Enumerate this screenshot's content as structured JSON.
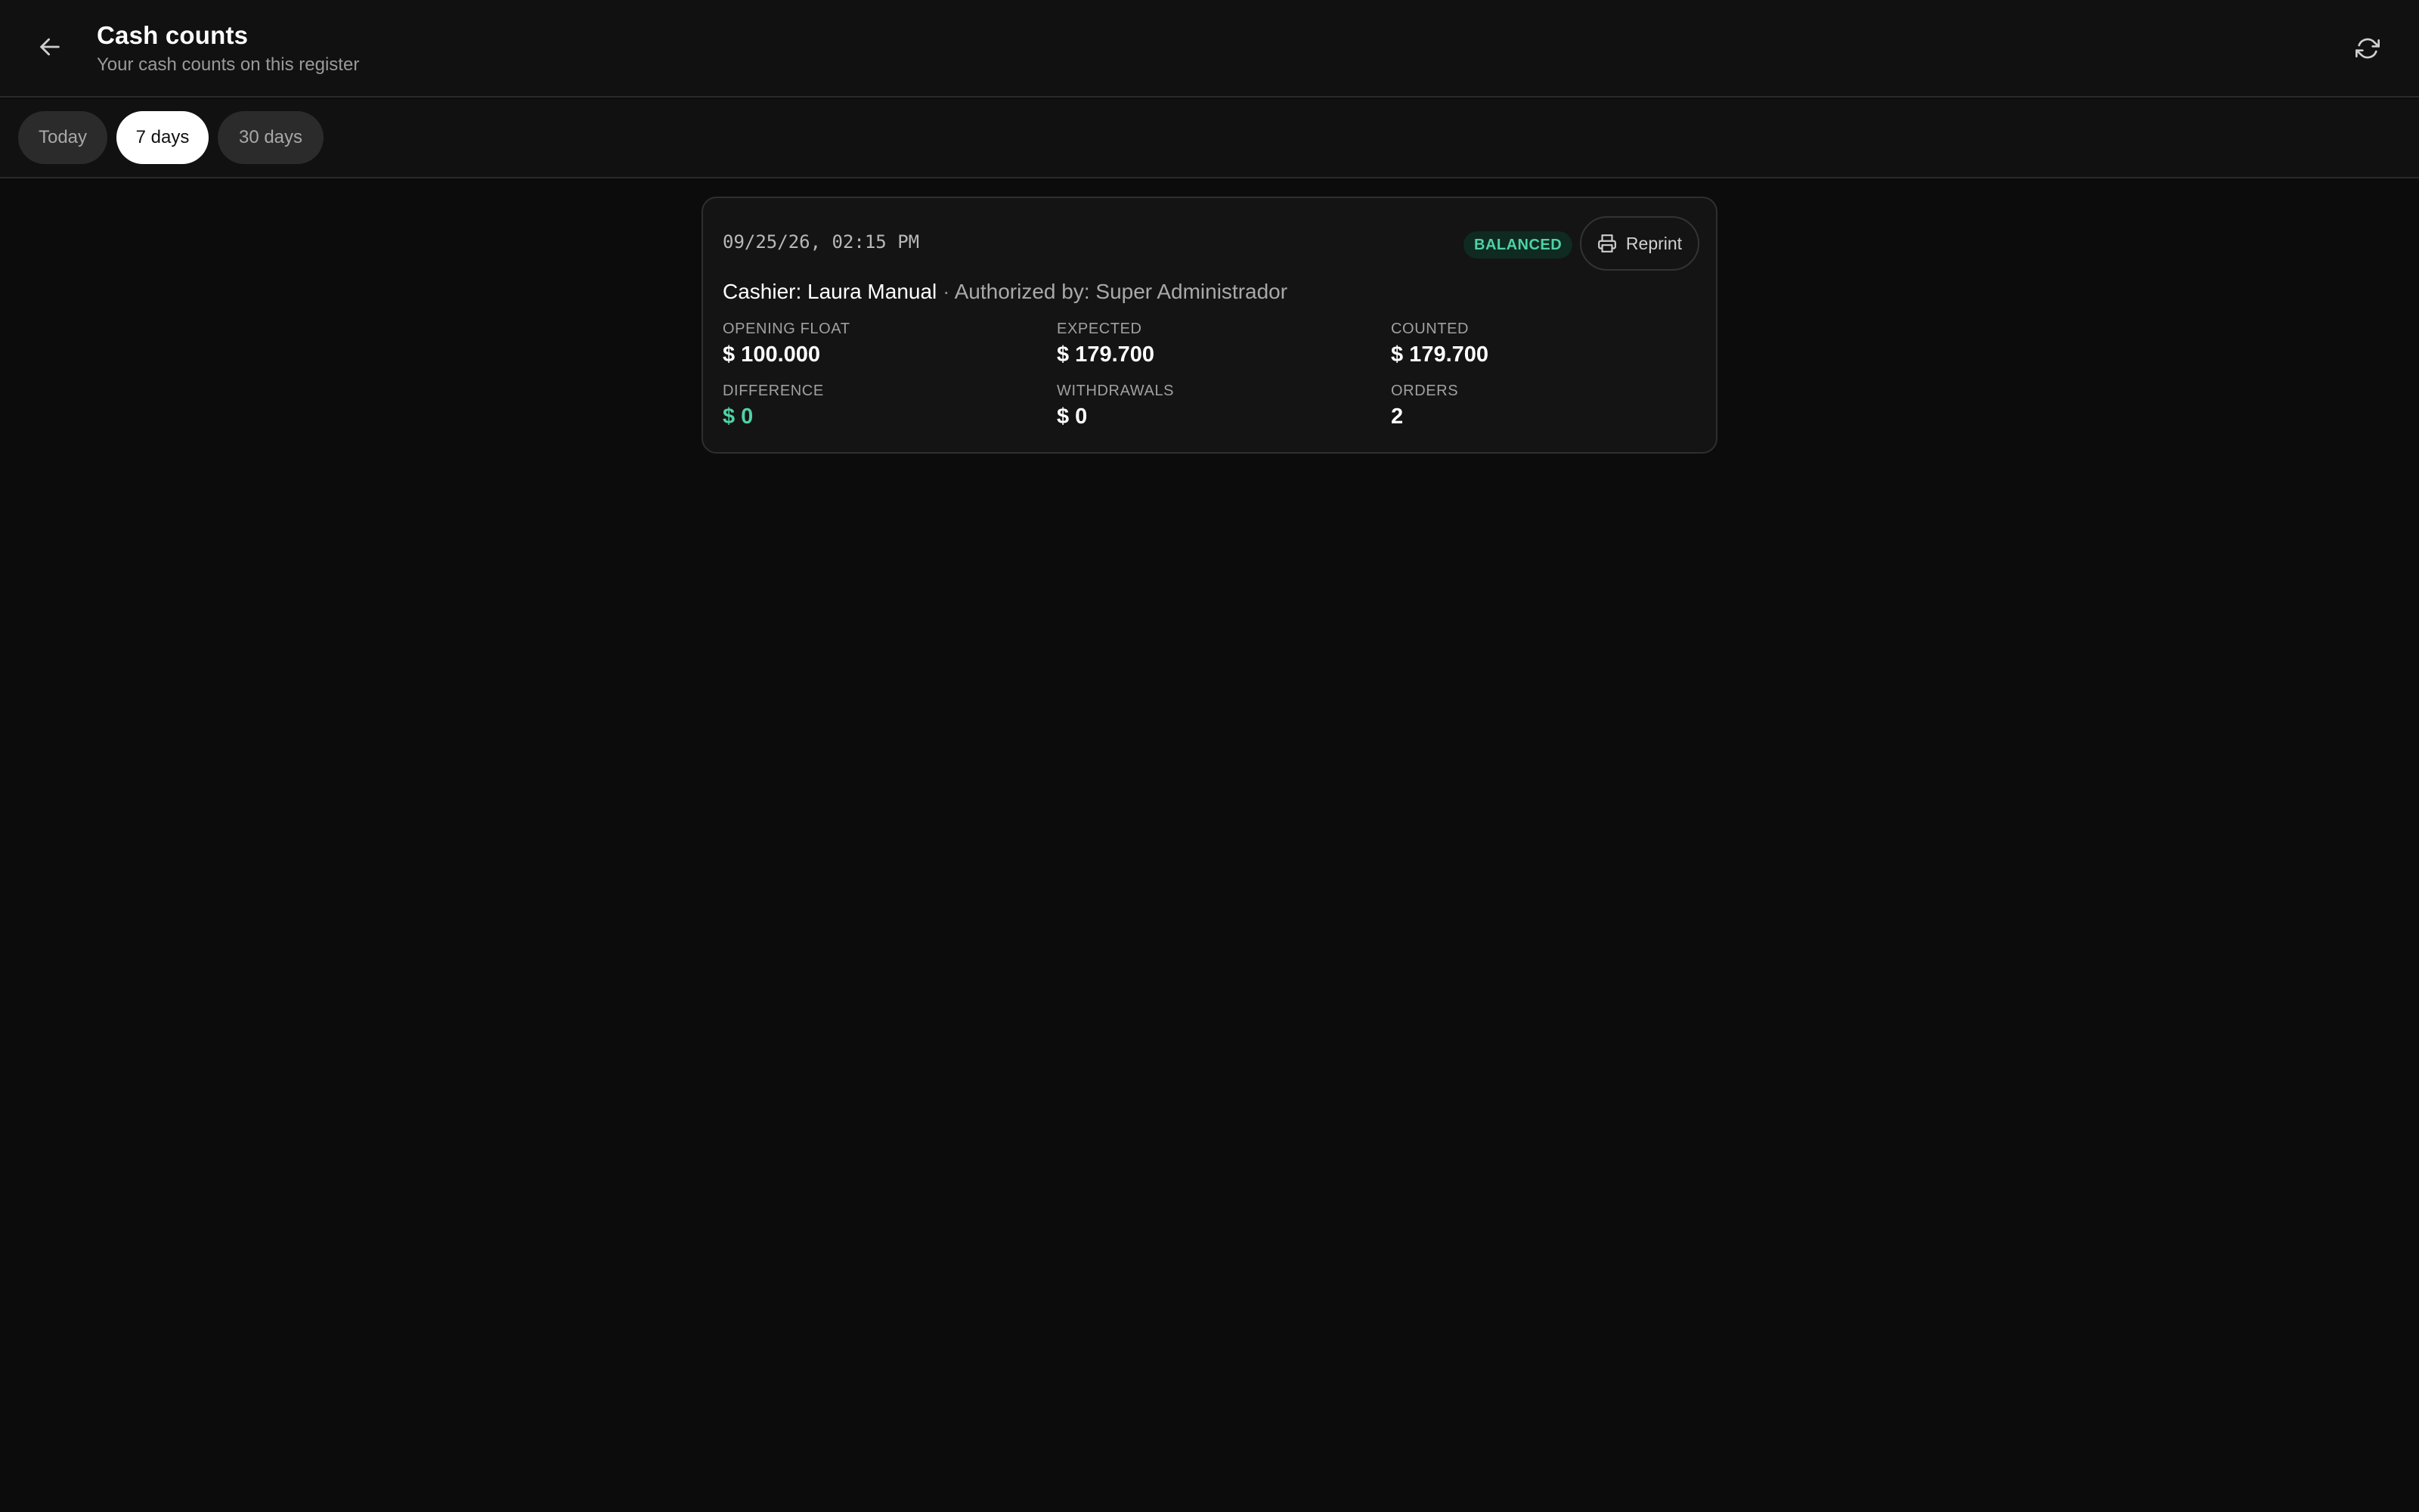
{
  "header": {
    "title": "Cash counts",
    "subtitle": "Your cash counts on this register",
    "back_icon": "arrow-left-icon",
    "refresh_icon": "refresh-icon"
  },
  "filters": {
    "options": [
      {
        "label": "Today",
        "selected": false
      },
      {
        "label": "7 days",
        "selected": true
      },
      {
        "label": "30 days",
        "selected": false
      }
    ]
  },
  "counts": [
    {
      "datetime": "09/25/26, 02:15 PM",
      "status": "BALANCED",
      "status_color": "#4fd1a5",
      "reprint_label": "Reprint",
      "reprint_icon": "printer-icon",
      "cashier": "Cashier: Laura Manual",
      "separator": "·",
      "authorized_by": "Authorized by: Super Administrador",
      "stats": {
        "opening_float": {
          "label": "OPENING FLOAT",
          "value": "$ 100.000"
        },
        "expected": {
          "label": "EXPECTED",
          "value": "$ 179.700"
        },
        "counted": {
          "label": "COUNTED",
          "value": "$ 179.700"
        },
        "difference": {
          "label": "DIFFERENCE",
          "value": "$ 0"
        },
        "withdrawals": {
          "label": "WITHDRAWALS",
          "value": "$ 0"
        },
        "orders": {
          "label": "ORDERS",
          "value": "2"
        }
      }
    }
  ],
  "colors": {
    "background": "#0c0c0c",
    "accent_green": "#4fd1a5"
  }
}
